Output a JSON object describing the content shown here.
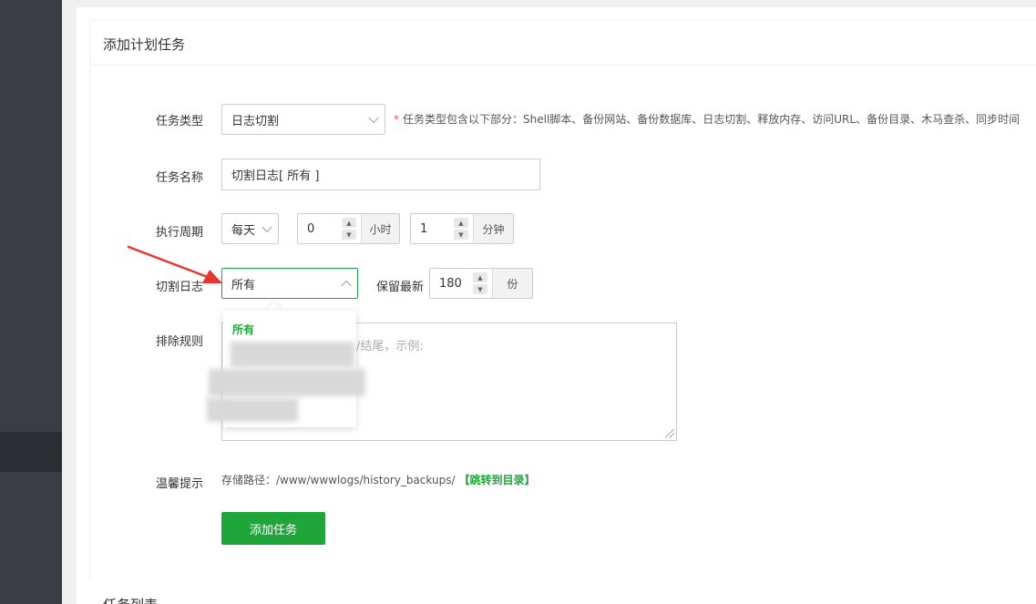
{
  "page": {
    "card_title": "添加计划任务",
    "list_title": "任务列表"
  },
  "form": {
    "task_type": {
      "label": "任务类型",
      "value": "日志切割"
    },
    "hint": "任务类型包含以下部分：Shell脚本、备份网站、备份数据库、日志切割、释放内存、访问URL、备份目录、木马查杀、同步时间",
    "hint_star": "*",
    "task_name": {
      "label": "任务名称",
      "value": "切割日志[ 所有 ]"
    },
    "period": {
      "label": "执行周期",
      "cycle": "每天",
      "hour_value": "0",
      "hour_unit": "小时",
      "minute_value": "1",
      "minute_unit": "分钟"
    },
    "cut_log": {
      "label": "切割日志",
      "value": "所有"
    },
    "keep": {
      "label": "保留最新",
      "value": "180",
      "unit": "份"
    },
    "exclude": {
      "label": "排除规则",
      "placeholder": "/结尾，示例:"
    },
    "tip": {
      "label": "温馨提示",
      "path": "存储路径：/www/wwwlogs/history_backups/",
      "link": "【跳转到目录】"
    },
    "submit": "添加任务"
  },
  "dropdown": {
    "options": [
      "所有"
    ]
  },
  "colors": {
    "accent": "#20a53a",
    "sidebar": "#3a3e44",
    "arrow": "#e8352f"
  }
}
